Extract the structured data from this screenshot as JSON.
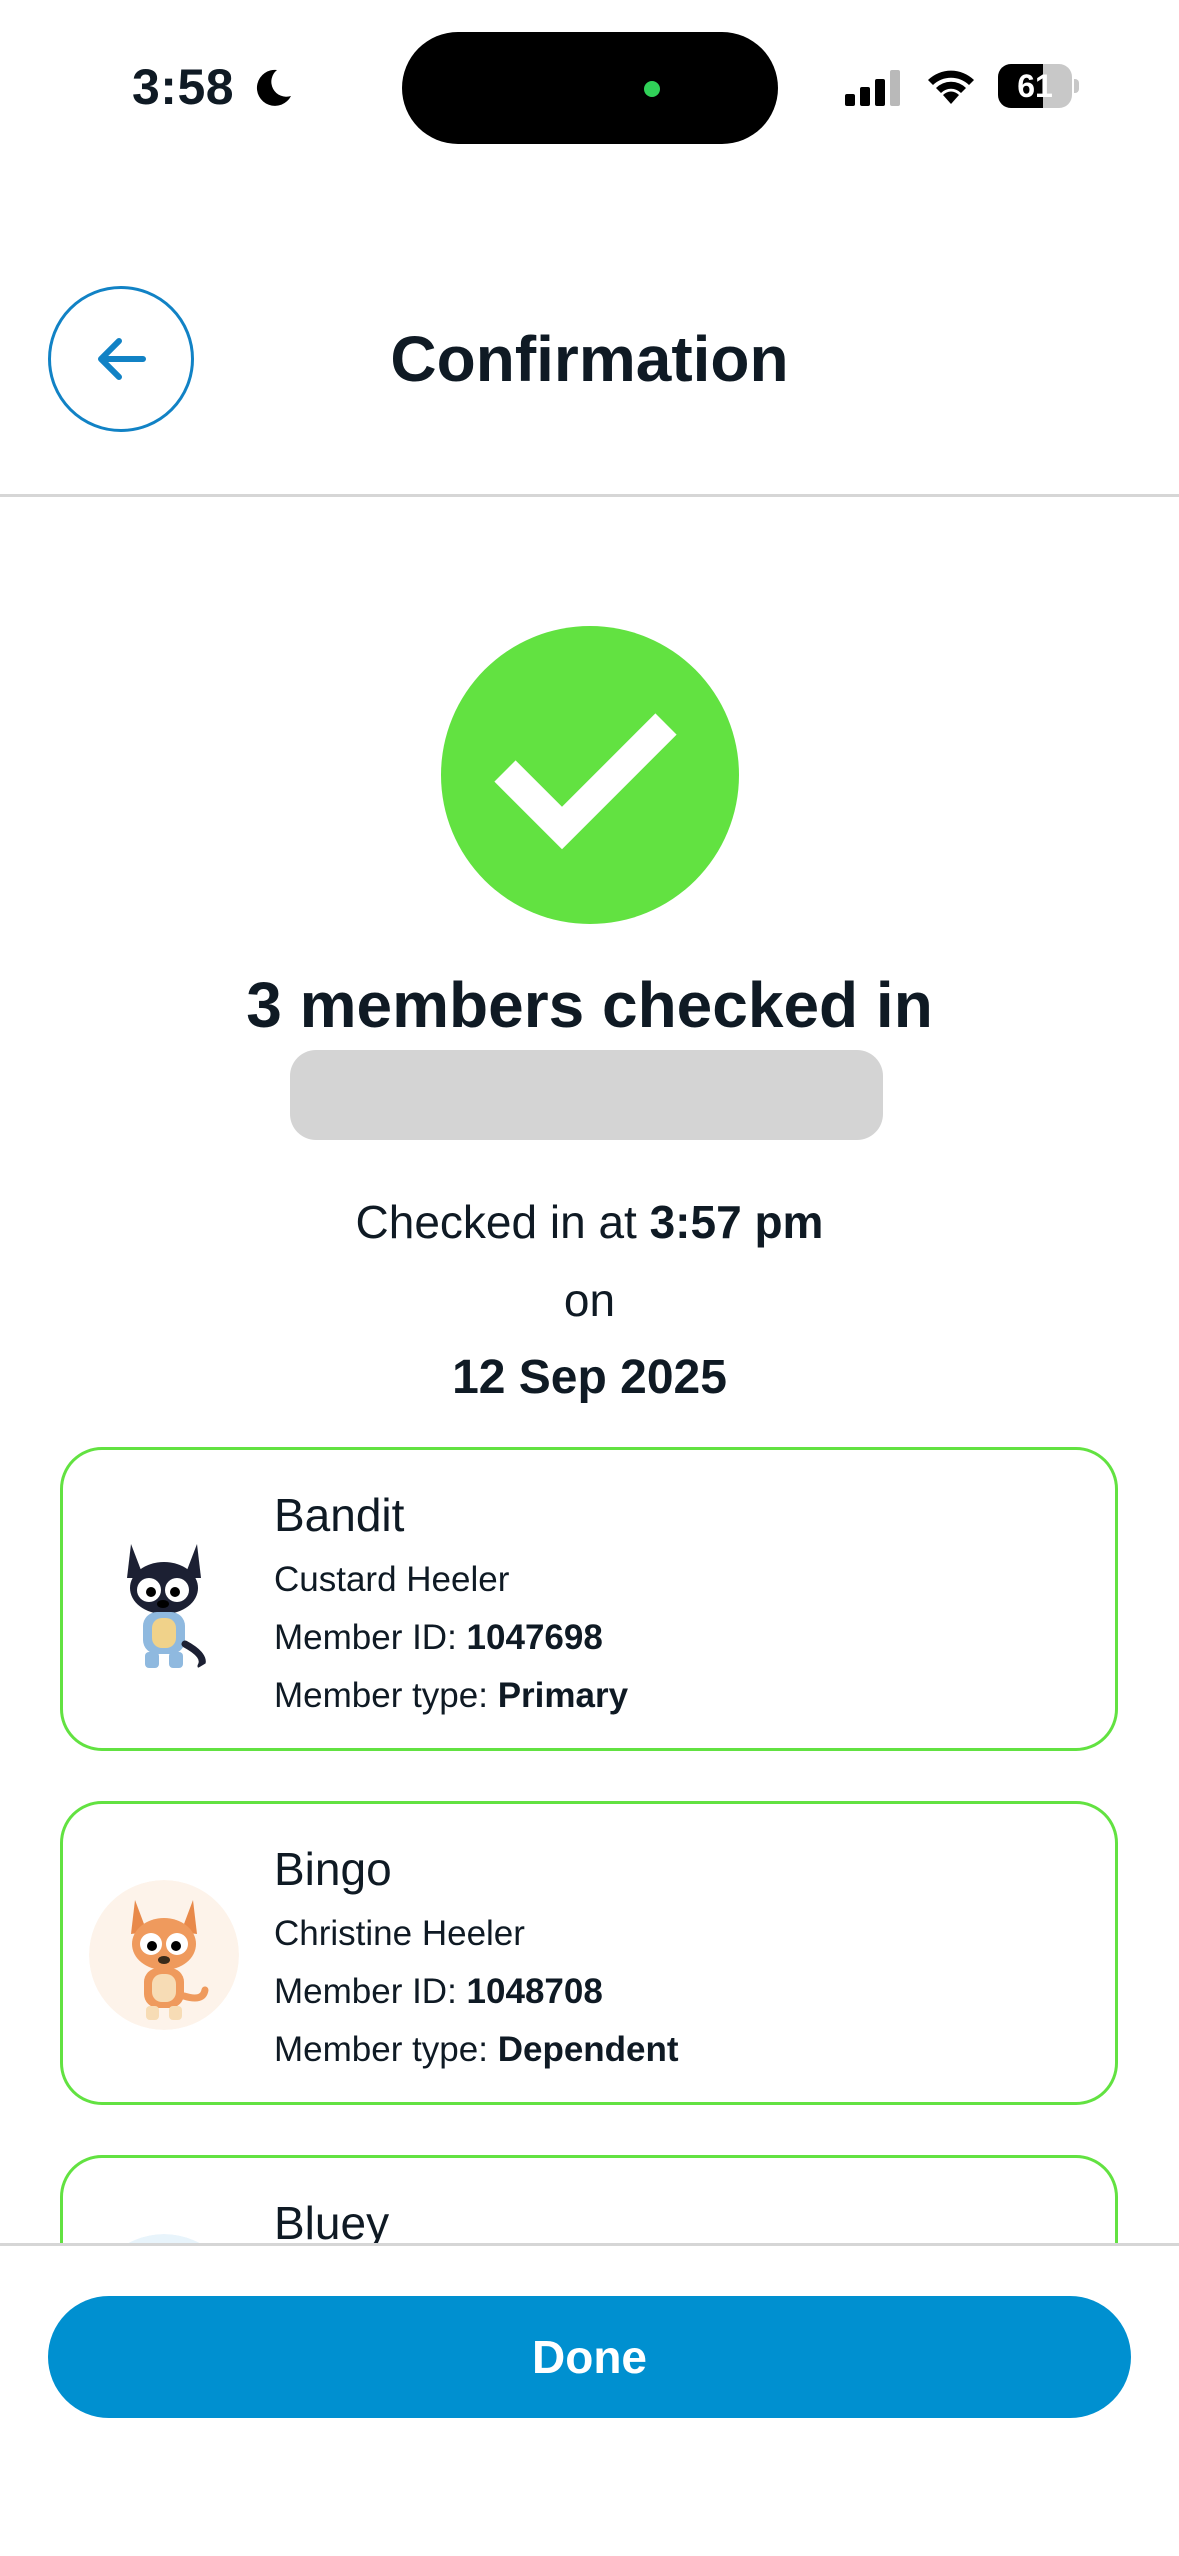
{
  "status_bar": {
    "time": "3:58",
    "battery_level": "61",
    "battery_fraction": 0.61
  },
  "header": {
    "back_icon": "arrow-left-icon",
    "title": "Confirmation"
  },
  "success": {
    "icon": "checkmark-icon",
    "headline": "3 members checked in",
    "checkin_prefix": "Checked in at",
    "checkin_time": "3:57 pm",
    "on_label": "on",
    "date": "12 Sep 2025"
  },
  "members": [
    {
      "name": "Bandit",
      "full_name": "Custard Heeler",
      "id_label": "Member ID:",
      "id": "1047698",
      "type_label": "Member type:",
      "type": "Primary",
      "avatar": "blue-heeler-dad-avatar"
    },
    {
      "name": "Bingo",
      "full_name": "Christine Heeler",
      "id_label": "Member ID:",
      "id": "1048708",
      "type_label": "Member type:",
      "type": "Dependent",
      "avatar": "red-heeler-pup-avatar"
    },
    {
      "name": "Bluey",
      "avatar": "blue-heeler-pup-avatar"
    }
  ],
  "footer": {
    "done_label": "Done"
  },
  "colors": {
    "accent": "#0090d0",
    "success": "#62e241",
    "text": "#0f1a24"
  }
}
